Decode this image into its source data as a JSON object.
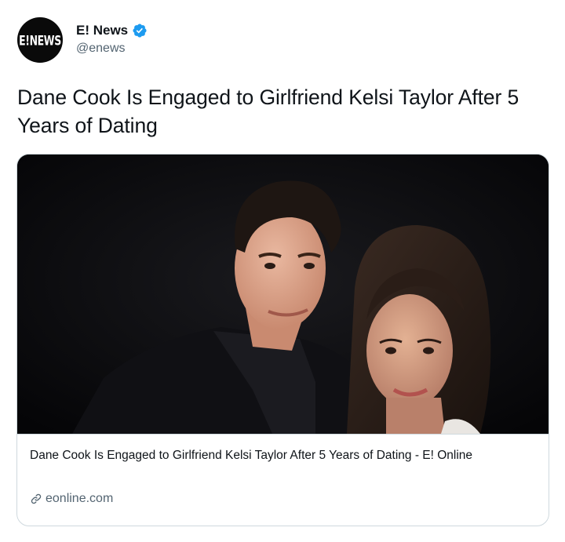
{
  "account": {
    "avatar_text": "E!NEWS",
    "display_name": "E! News",
    "handle": "@enews",
    "verified": true
  },
  "tweet": {
    "text": "Dane Cook Is Engaged to Girlfriend Kelsi Taylor After 5 Years of Dating"
  },
  "card": {
    "title": "Dane Cook Is Engaged to Girlfriend Kelsi Taylor After 5 Years of Dating - E! Online",
    "domain": "eonline.com"
  },
  "icons": {
    "verified": "verified-badge-icon",
    "link": "link-icon"
  },
  "colors": {
    "verified_blue": "#1d9bf0",
    "secondary_text": "#536471",
    "card_border": "#cfd9de",
    "avatar_bg": "#0a0a0a"
  }
}
